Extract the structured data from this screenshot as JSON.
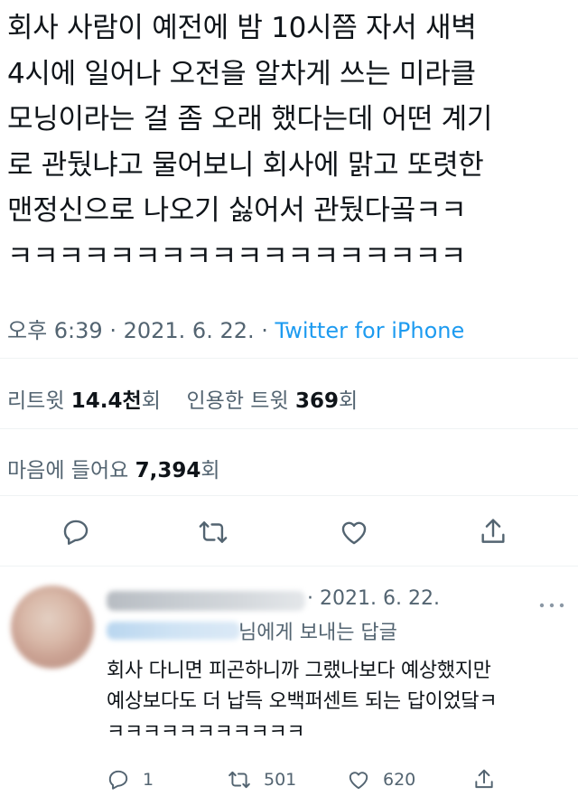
{
  "tweet": {
    "lines": [
      "회사 사람이 예전에 밤 10시쯤 자서 새벽",
      "4시에 일어나 오전을 알차게 쓰는 미라클",
      "모닝이라는 걸 좀 오래 했다는데 어떤 계기",
      "로 관뒀냐고 물어보니 회사에 맑고 또렷한",
      "맨정신으로 나오기 싫어서 관뒀다곸ㅋㅋ",
      "ㅋㅋㅋㅋㅋㅋㅋㅋㅋㅋㅋㅋㅋㅋㅋㅋㅋㅋ"
    ],
    "time": "오후 6:39",
    "date": "2021. 6. 22.",
    "source": "Twitter for iPhone"
  },
  "stats": {
    "retweet_label": "리트윗",
    "retweet_count": "14.4천",
    "retweet_suffix": "회",
    "quote_label": "인용한 트윗",
    "quote_count": "369",
    "quote_suffix": "회",
    "likes_label": "마음에 들어요",
    "likes_count": "7,394",
    "likes_suffix": "회"
  },
  "actions": {
    "icons": [
      "reply-icon",
      "retweet-icon",
      "like-icon",
      "share-icon"
    ]
  },
  "reply": {
    "date": "2021. 6. 22.",
    "replying_to": "님에게 보내는 답글",
    "lines": [
      "회사 다니면 피곤하니까 그랬나보다 예상했지만",
      "예상보다도 더 납득 오백퍼센트 되는 답이었닼ㅋ",
      "ㅋㅋㅋㅋㅋㅋㅋㅋㅋㅋㅋ"
    ],
    "reply_count": "1",
    "retweet_count": "501",
    "like_count": "620"
  },
  "colors": {
    "text": "#0f1419",
    "muted": "#536471",
    "accent": "#1d9bf0",
    "divider": "#eff3f4"
  }
}
